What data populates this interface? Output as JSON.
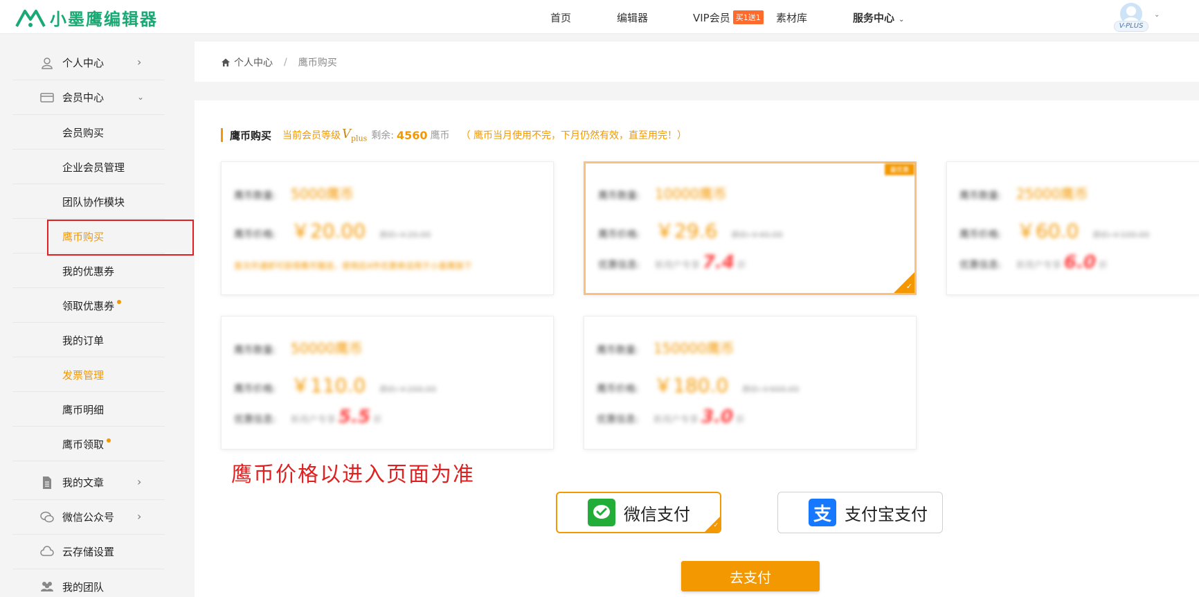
{
  "header": {
    "logo_text": "小墨鹰编辑器",
    "nav": {
      "home": "首页",
      "editor": "编辑器",
      "vip": "VIP会员",
      "vip_badge": "买1送1",
      "materials": "素材库",
      "service": "服务中心"
    },
    "avatar_badge": "V-PLUS"
  },
  "sidebar": {
    "personal_center": "个人中心",
    "member_center": "会员中心",
    "sub": {
      "member_buy": "会员购买",
      "enterprise": "企业会员管理",
      "team_module": "团队协作模块",
      "coin_buy": "鹰币购买",
      "my_coupons": "我的优惠券",
      "get_coupons": "领取优惠券",
      "my_orders": "我的订单",
      "invoice": "发票管理",
      "coin_detail": "鹰币明细",
      "coin_claim": "鹰币领取"
    },
    "my_articles": "我的文章",
    "wechat_accounts": "微信公众号",
    "cloud_storage": "云存储设置",
    "my_team": "我的团队"
  },
  "breadcrumb": {
    "home": "个人中心",
    "sep": "/",
    "current": "鹰币购买"
  },
  "main": {
    "title": "鹰币购买",
    "level_label": "当前会员等级",
    "level_badge": "V",
    "level_sub": "plus",
    "remaining_label": "剩余:",
    "remaining_value": "4560",
    "remaining_unit": "鹰币",
    "note": "（ 鹰币当月使用不完，下月仍然有效，直至用完！）",
    "price_note": "鹰币价格以进入页面为准",
    "labels": {
      "amount": "鹰币数量:",
      "price": "鹰币价格:",
      "discount": "优惠信息:",
      "discount_pre": "新用户专享",
      "discount_suffix": "折"
    },
    "packages": [
      {
        "amount": "5000鹰币",
        "price": "￥20.00",
        "original": "原价:￥20.00",
        "promo": "首次开通即可获得鹰币赠送，使用后4件优惠券适用于小墨鹰旗下"
      },
      {
        "amount": "10000鹰币",
        "price": "￥29.6",
        "original": "原价:￥40.00",
        "discount": "7.4",
        "tag": "最优惠"
      },
      {
        "amount": "25000鹰币",
        "price": "￥60.0",
        "original": "原价:￥100.00",
        "discount": "6.0"
      },
      {
        "amount": "50000鹰币",
        "price": "￥110.0",
        "original": "原价:￥200.00",
        "discount": "5.5"
      },
      {
        "amount": "150000鹰币",
        "price": "￥180.0",
        "original": "原价:￥600.00",
        "discount": "3.0"
      }
    ],
    "pay": {
      "wechat": "微信支付",
      "alipay": "支付宝支付",
      "submit": "去支付"
    }
  },
  "colors": {
    "accent": "#f39800",
    "brand": "#19a974",
    "highlight_red": "#e02020"
  }
}
